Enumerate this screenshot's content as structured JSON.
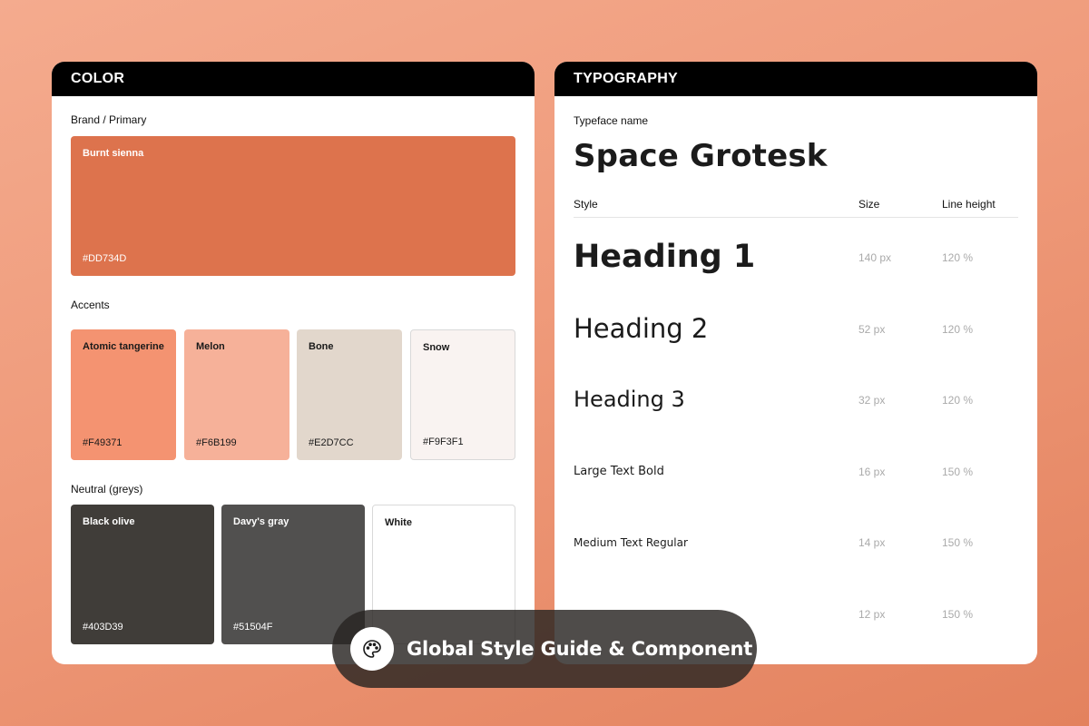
{
  "color_panel": {
    "title": "COLOR",
    "brand": {
      "label": "Brand / Primary",
      "swatch": {
        "name": "Burnt sienna",
        "hex": "#DD734D",
        "color": "#DD734D"
      }
    },
    "accents": {
      "label": "Accents",
      "swatches": [
        {
          "name": "Atomic tangerine",
          "hex": "#F49371",
          "color": "#F49371"
        },
        {
          "name": "Melon",
          "hex": "#F6B199",
          "color": "#F6B199"
        },
        {
          "name": "Bone",
          "hex": "#E2D7CC",
          "color": "#E2D7CC"
        },
        {
          "name": "Snow",
          "hex": "#F9F3F1",
          "color": "#F9F3F1"
        }
      ]
    },
    "neutrals": {
      "label": "Neutral (greys)",
      "swatches": [
        {
          "name": "Black olive",
          "hex": "#403D39",
          "color": "#403D39"
        },
        {
          "name": "Davy's gray",
          "hex": "#51504F",
          "color": "#51504F"
        },
        {
          "name": "White",
          "hex": "",
          "color": "#FFFFFF"
        }
      ]
    }
  },
  "typography_panel": {
    "title": "TYPOGRAPHY",
    "typeface_label": "Typeface name",
    "typeface_name": "Space Grotesk",
    "columns": {
      "style": "Style",
      "size": "Size",
      "line_height": "Line height"
    },
    "rows": [
      {
        "style": "Heading 1",
        "size": "140 px",
        "line_height": "120 %"
      },
      {
        "style": "Heading 2",
        "size": "52 px",
        "line_height": "120 %"
      },
      {
        "style": "Heading 3",
        "size": "32 px",
        "line_height": "120 %"
      },
      {
        "style": "Large Text Bold",
        "size": "16 px",
        "line_height": "150 %"
      },
      {
        "style": "Medium Text Regular",
        "size": "14 px",
        "line_height": "150 %"
      },
      {
        "style": "",
        "size": "12 px",
        "line_height": "150 %"
      }
    ]
  },
  "banner": {
    "icon": "palette-icon",
    "text": "Global Style Guide & Component"
  }
}
